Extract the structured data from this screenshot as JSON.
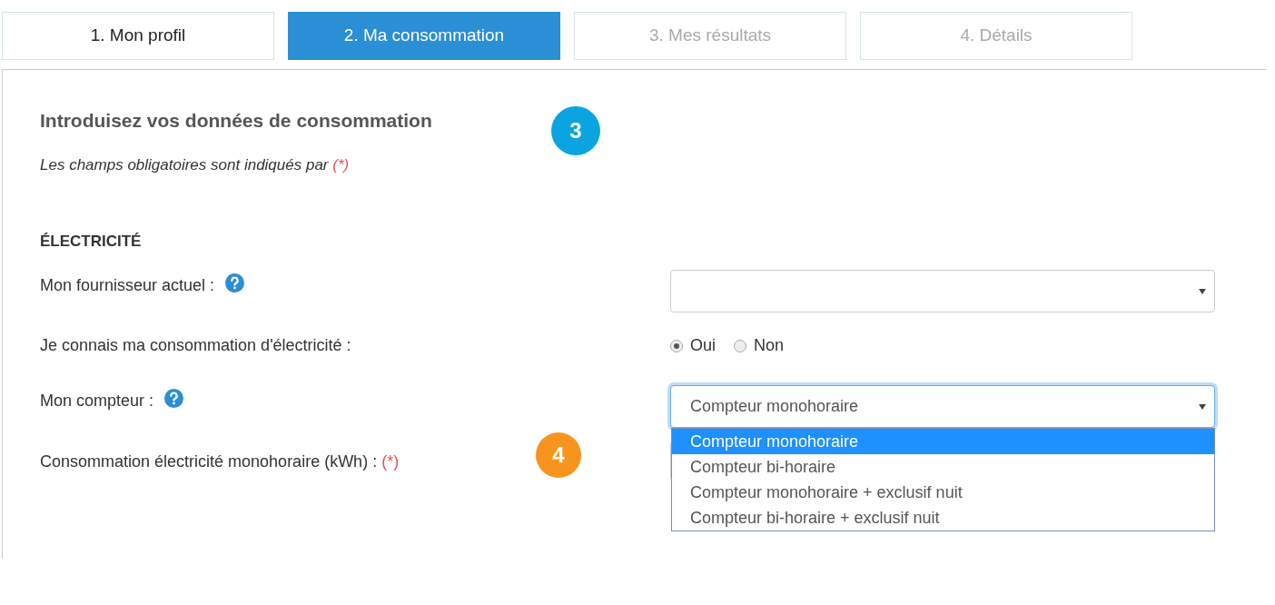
{
  "tabs": [
    {
      "label": "1. Mon profil",
      "selected": false,
      "disabled": false
    },
    {
      "label": "2. Ma consommation",
      "selected": true,
      "disabled": false
    },
    {
      "label": "3. Mes résultats",
      "selected": false,
      "disabled": true
    },
    {
      "label": "4. Détails",
      "selected": false,
      "disabled": true
    }
  ],
  "heading": {
    "text": "Introduisez vos données de consommation",
    "badge": {
      "label": "3",
      "color": "#0aa5e0"
    }
  },
  "note": {
    "text": "Les champs obligatoires sont indiqués par",
    "required_mark": "(*)"
  },
  "section": "ÉLECTRICITÉ",
  "fields": [
    {
      "kind": "select",
      "label": "Mon fournisseur actuel :",
      "help": true,
      "expanded": false
    },
    {
      "kind": "radio",
      "label": "Je connais ma consommation d'électricité :",
      "help": false,
      "options": [
        {
          "label": "Oui",
          "selected": true
        },
        {
          "label": "Non",
          "selected": false
        }
      ]
    },
    {
      "kind": "select",
      "label": "Mon compteur :",
      "help": true,
      "value": "Compteur monohoraire",
      "expanded": true,
      "options": [
        {
          "label": "Compteur monohoraire",
          "selected": true
        },
        {
          "label": "Compteur bi-horaire",
          "selected": false
        },
        {
          "label": "Compteur monohoraire + exclusif nuit",
          "selected": false
        },
        {
          "label": "Compteur bi-horaire + exclusif nuit",
          "selected": false
        }
      ]
    },
    {
      "kind": "input",
      "label": "Consommation électricité monohoraire (kWh) :",
      "help": false,
      "required_mark": "(*)",
      "badge": {
        "label": "4",
        "color": "#f7941d"
      }
    }
  ]
}
